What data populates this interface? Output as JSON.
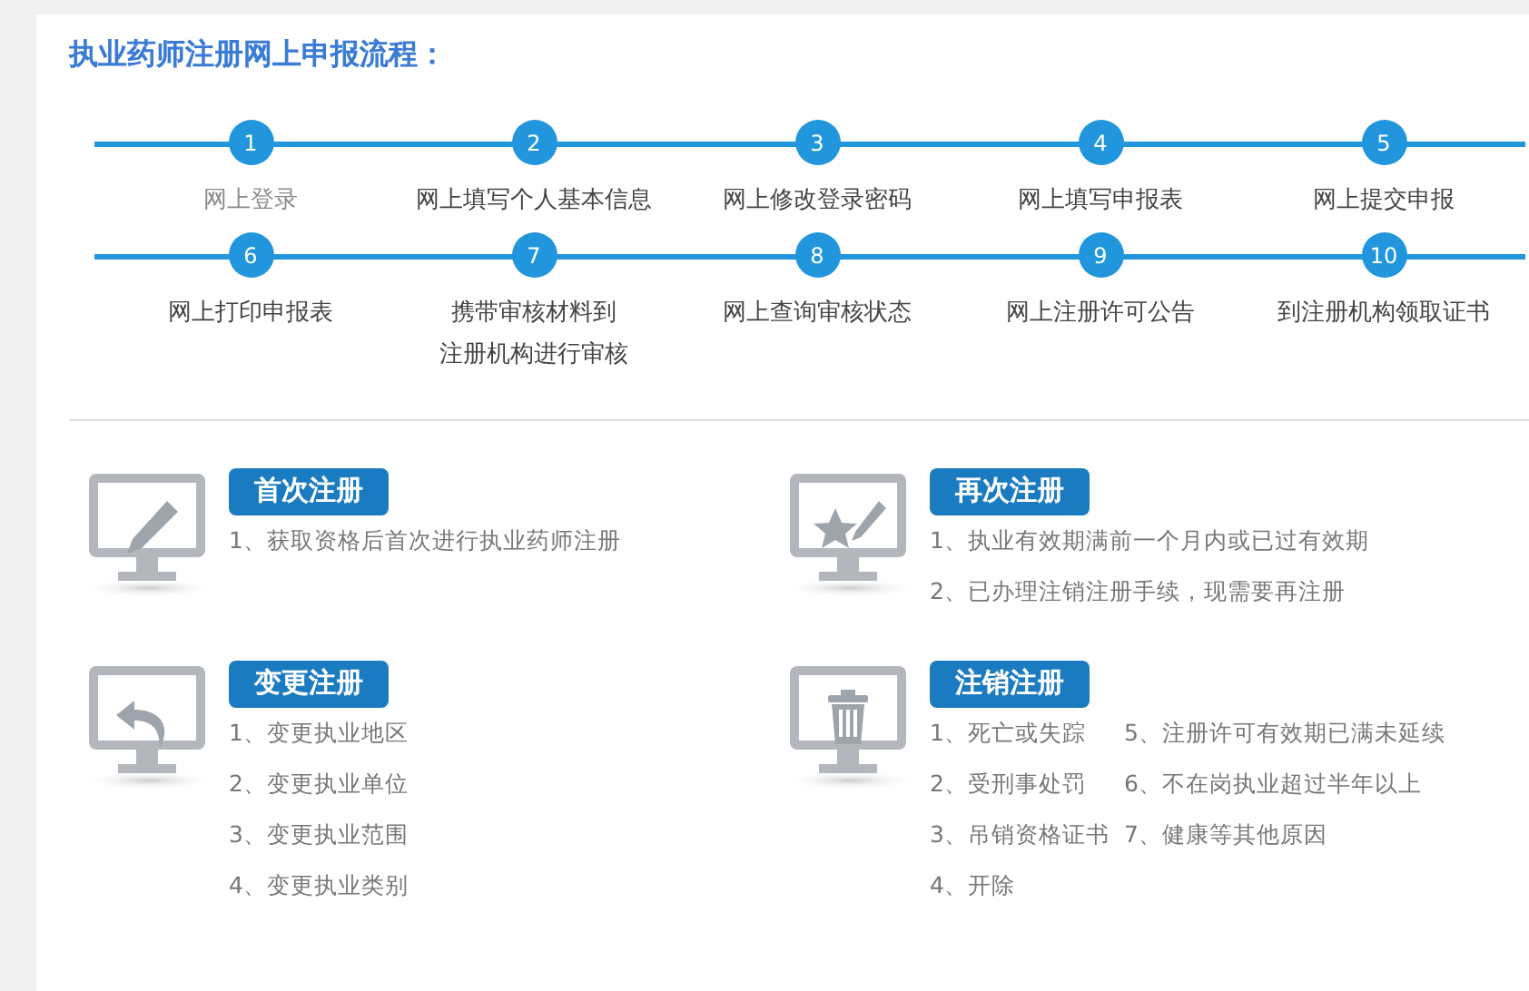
{
  "title": "执业药师注册网上申报流程：",
  "step_rows": [
    [
      {
        "number": "1",
        "label": "网上登录",
        "dimmed": true
      },
      {
        "number": "2",
        "label": "网上填写个人基本信息",
        "dimmed": false
      },
      {
        "number": "3",
        "label": "网上修改登录密码",
        "dimmed": false
      },
      {
        "number": "4",
        "label": "网上填写申报表",
        "dimmed": false
      },
      {
        "number": "5",
        "label": "网上提交申报",
        "dimmed": false
      }
    ],
    [
      {
        "number": "6",
        "label": "网上打印申报表",
        "dimmed": false
      },
      {
        "number": "7",
        "label_lines": [
          "携带审核材料到",
          "注册机构进行审核"
        ],
        "dimmed": false
      },
      {
        "number": "8",
        "label": "网上查询审核状态",
        "dimmed": false
      },
      {
        "number": "9",
        "label": "网上注册许可公告",
        "dimmed": false
      },
      {
        "number": "10",
        "label": "到注册机构领取证书",
        "dimmed": false
      }
    ]
  ],
  "cards": [
    {
      "kind": "pencil",
      "title": "首次注册",
      "item_columns": [
        [
          "1、获取资格后首次进行执业药师注册"
        ]
      ]
    },
    {
      "kind": "star",
      "title": "再次注册",
      "item_columns": [
        [
          "1、执业有效期满前一个月内或已过有效期",
          "2、已办理注销注册手续，现需要再注册"
        ]
      ]
    },
    {
      "kind": "undo",
      "title": "变更注册",
      "item_columns": [
        [
          "1、变更执业地区",
          "2、变更执业单位",
          "3、变更执业范围",
          "4、变更执业类别"
        ]
      ]
    },
    {
      "kind": "trash",
      "title": "注销注册",
      "item_columns": [
        [
          "1、死亡或失踪",
          "2、受刑事处罚",
          "3、吊销资格证书",
          "4、开除"
        ],
        [
          "5、注册许可有效期已满未延续",
          "6、不在岗执业超过半年以上",
          "7、健康等其他原因"
        ]
      ]
    }
  ]
}
